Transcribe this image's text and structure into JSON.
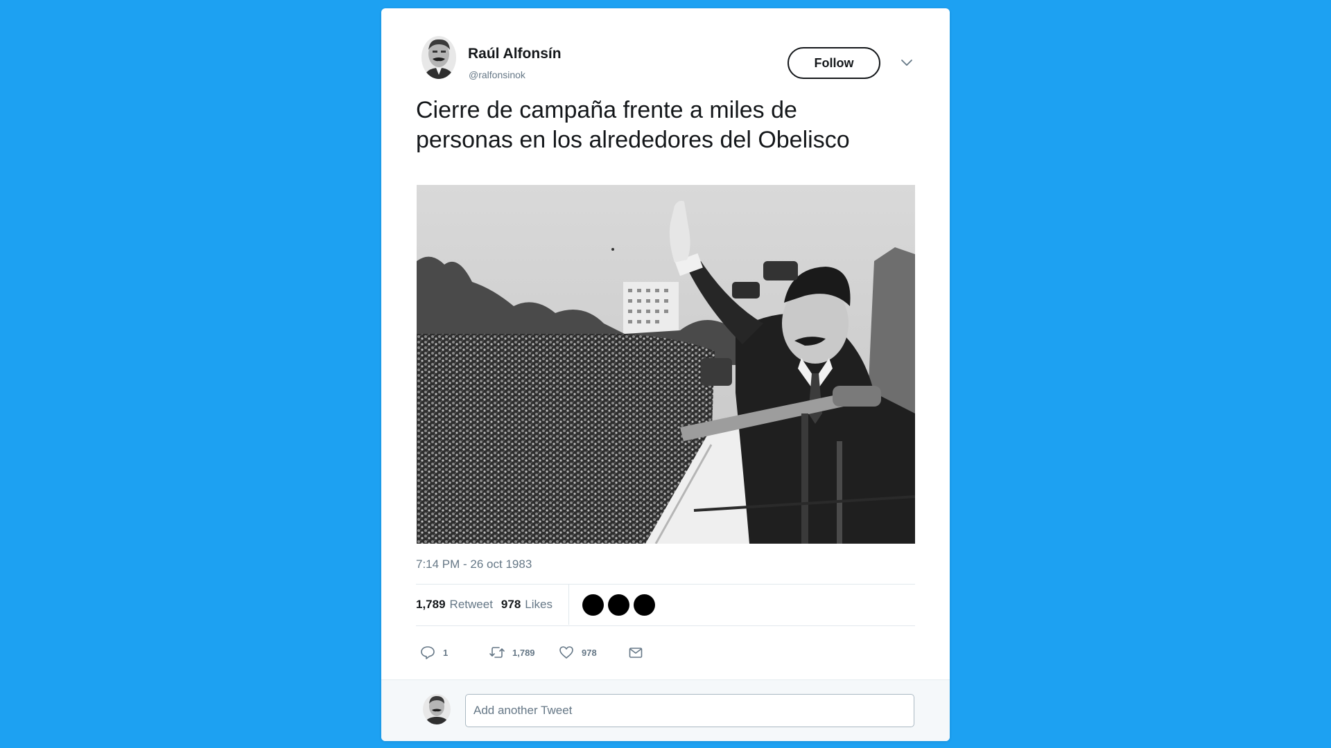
{
  "author": {
    "name": "Raúl Alfonsín",
    "handle": "@ralfonsinok",
    "avatar_icon": "portrait-avatar-icon"
  },
  "header": {
    "follow_label": "Follow",
    "menu_icon": "chevron-down-icon"
  },
  "tweet": {
    "text_line1": "Cierre de campaña frente a miles de",
    "text_line2": "personas en los alrededores del Obelisco",
    "timestamp": "7:14 PM - 26 oct 1983"
  },
  "stats": {
    "retweets": "1,789",
    "retweets_label": "Retweet",
    "likes": "978",
    "likes_label": "Likes"
  },
  "actions": {
    "replies": "1",
    "retweets": "1,789",
    "likes": "978",
    "icons": [
      "reply-icon",
      "retweet-icon",
      "heart-icon",
      "mail-icon"
    ]
  },
  "reply": {
    "placeholder": "Add another Tweet"
  },
  "colors": {
    "background": "#1da1f2",
    "card": "#ffffff",
    "text": "#14171a",
    "muted": "#657786"
  }
}
